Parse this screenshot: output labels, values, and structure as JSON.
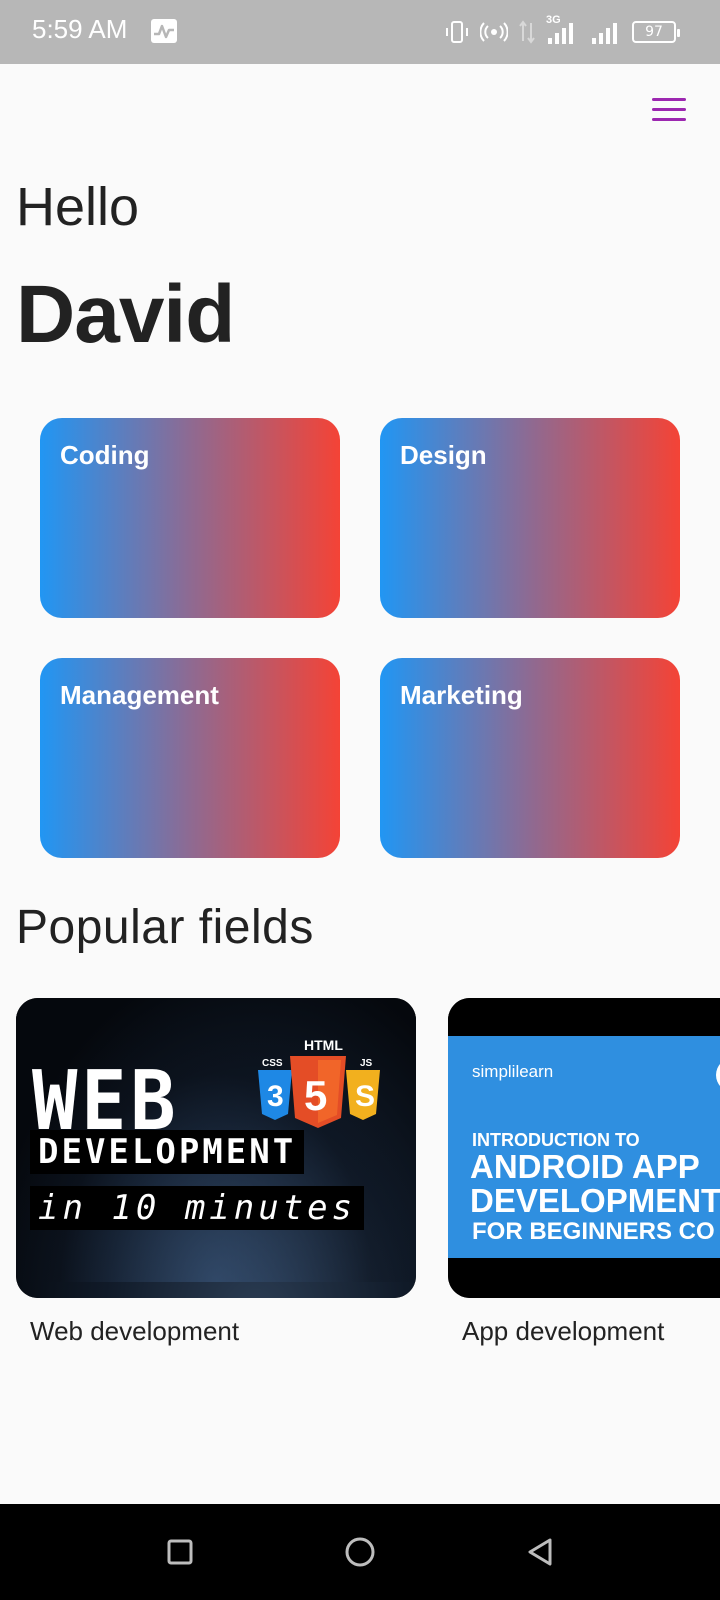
{
  "status_bar": {
    "time": "5:59 AM",
    "network": "3G",
    "battery": "97",
    "icons": [
      "activity-icon",
      "vibrate-icon",
      "hotspot-icon",
      "data-arrows-icon",
      "signal-icon",
      "signal-icon",
      "battery-icon"
    ]
  },
  "header": {
    "menu_icon": "hamburger-menu-icon",
    "accent_color": "#9c27b0"
  },
  "greeting": {
    "hello": "Hello",
    "name": "David"
  },
  "categories": [
    {
      "label": "Coding"
    },
    {
      "label": "Design"
    },
    {
      "label": "Management"
    },
    {
      "label": "Marketing"
    }
  ],
  "category_gradient": {
    "from": "#2196f3",
    "to": "#f44336"
  },
  "popular": {
    "title": "Popular fields",
    "courses": [
      {
        "caption": "Web development",
        "thumbnail": {
          "title": "WEB",
          "subtitle": "DEVELOPMENT",
          "tagline": "in 10 minutes",
          "badge_top": "HTML",
          "badge_left": "CSS",
          "badge_right": "JS",
          "num_left": "3",
          "num_center": "5",
          "num_right": "S"
        }
      },
      {
        "caption": "App development",
        "thumbnail": {
          "brand": "simplilearn",
          "intro": "INTRODUCTION TO",
          "line1": "ANDROID APP",
          "line2": "DEVELOPMENT",
          "line3": "FOR BEGINNERS CO"
        }
      }
    ]
  },
  "nav_bar": {
    "buttons": [
      "recents-square-icon",
      "home-circle-icon",
      "back-triangle-icon"
    ]
  }
}
